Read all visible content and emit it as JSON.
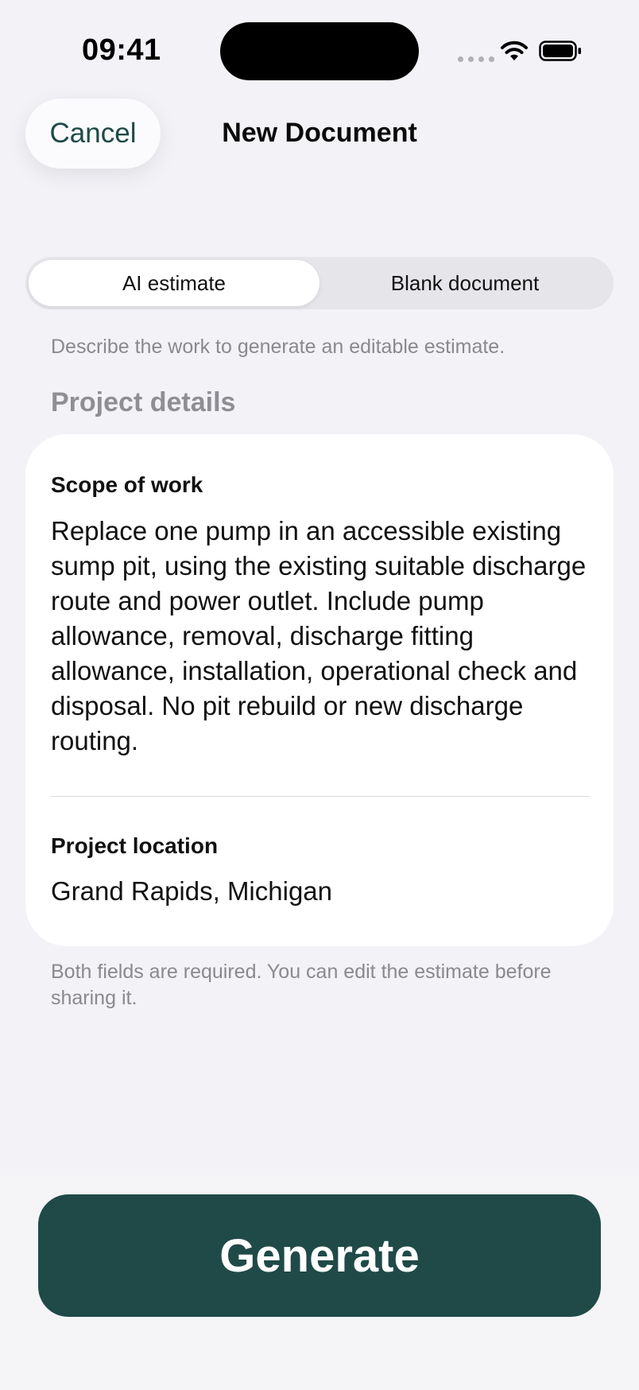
{
  "status_bar": {
    "time": "09:41",
    "icons": [
      "signal-dots-icon",
      "wifi-icon",
      "battery-icon"
    ]
  },
  "nav": {
    "cancel_label": "Cancel",
    "title": "New Document"
  },
  "segmented": {
    "options": [
      {
        "label": "AI estimate",
        "selected": true
      },
      {
        "label": "Blank document",
        "selected": false
      }
    ]
  },
  "helper_text": "Describe the work to generate an editable estimate.",
  "section_header": "Project details",
  "form": {
    "scope": {
      "label": "Scope of work",
      "value": "Replace one pump in an accessible existing sump pit, using the existing suitable discharge route and power outlet. Include pump allowance, removal, discharge fitting allowance, installation, operational check and disposal. No pit rebuild or new discharge routing."
    },
    "location": {
      "label": "Project location",
      "value": "Grand Rapids, Michigan"
    }
  },
  "footnote": "Both fields are required. You can edit the estimate before sharing it.",
  "primary_button": {
    "label": "Generate"
  },
  "colors": {
    "accent": "#1f4a48",
    "background": "#f2f2f7",
    "secondary_text": "#8a8a8e"
  }
}
